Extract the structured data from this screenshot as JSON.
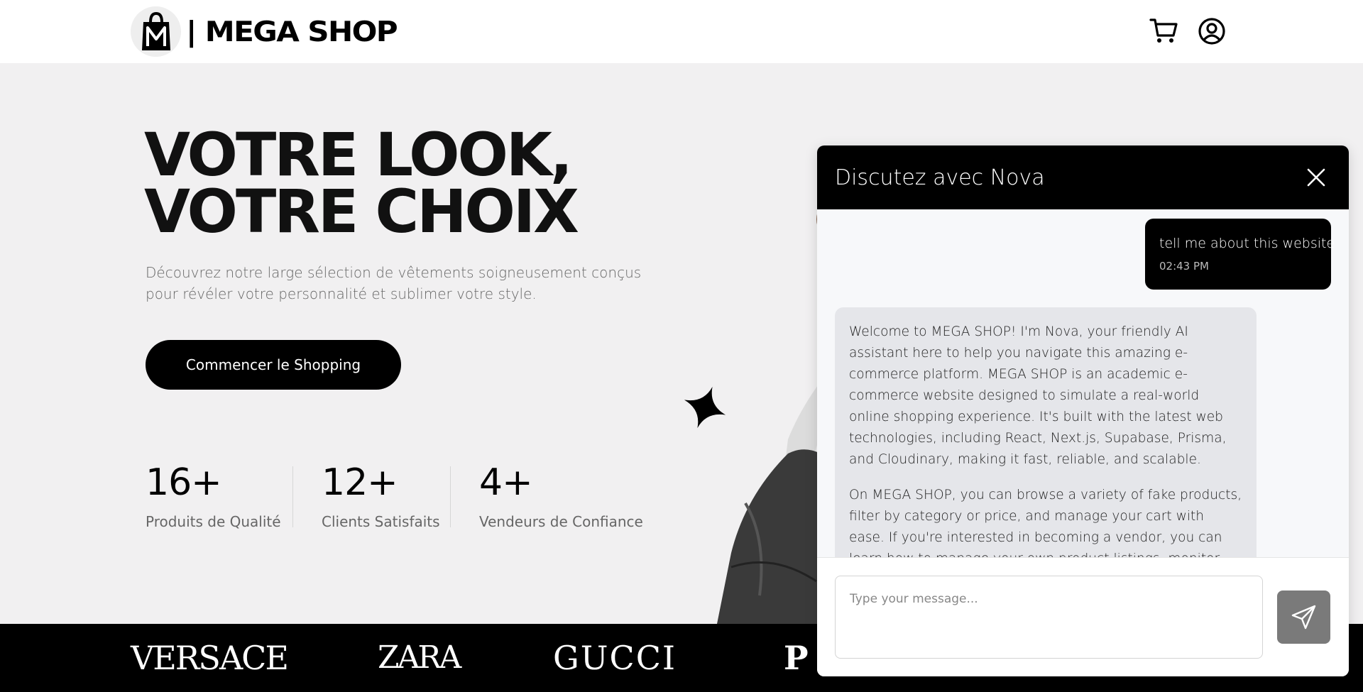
{
  "header": {
    "brand": "| MEGA SHOP",
    "logo_icon": "shopping-bag-m-logo",
    "cart_icon": "cart-icon",
    "user_icon": "user-circle-icon"
  },
  "hero": {
    "title_line1": "VOTRE LOOK,",
    "title_line2": "VOTRE CHOIX",
    "description": "Découvrez notre large sélection de vêtements soigneusement conçus pour révéler votre personnalité et sublimer votre style.",
    "cta_label": "Commencer le Shopping",
    "stats": [
      {
        "value": "16+",
        "label": "Produits de Qualité"
      },
      {
        "value": "12+",
        "label": "Clients Satisfaits"
      },
      {
        "value": "4+",
        "label": "Vendeurs de Confiance"
      }
    ]
  },
  "brands": [
    "VERSACE",
    "ZARA",
    "GUCCI",
    "P"
  ],
  "chat": {
    "title": "Discutez avec Nova",
    "user_message": {
      "text": "tell me about this website",
      "time": "02:43 PM"
    },
    "bot_message": {
      "paragraph1": "Welcome to MEGA SHOP! I'm Nova, your friendly AI assistant here to help you navigate this amazing e-commerce platform. MEGA SHOP is an academic e-commerce website designed to simulate a real-world online shopping experience. It's built with the latest web technologies, including React, Next.js, Supabase, Prisma, and Cloudinary, making it fast, reliable, and scalable.",
      "paragraph2": "On MEGA SHOP, you can browse a variety of fake products, filter by category or price, and manage your cart with ease. If you're interested in becoming a vendor, you can learn how to manage your own product listings, monitor sales, and access dashboards with analytics."
    },
    "input_placeholder": "Type your message...",
    "send_icon": "send-icon",
    "close_icon": "close-icon"
  },
  "colors": {
    "accent": "#000000",
    "hero_bg": "#f1f0f1",
    "bot_bubble": "#e5e6ea",
    "send_button": "#7a7a7a"
  }
}
